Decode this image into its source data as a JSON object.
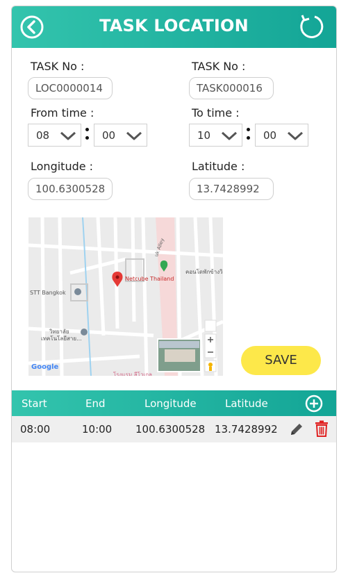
{
  "header": {
    "title": "TASK LOCATION"
  },
  "form": {
    "task_no_label_left": "TASK No :",
    "task_no_value_left": "LOC0000014",
    "task_no_label_right": "TASK No :",
    "task_no_value_right": "TASK000016",
    "from_time_label": "From time :",
    "from_hour": "08",
    "from_minute": "00",
    "to_time_label": "To time :",
    "to_hour": "10",
    "to_minute": "00",
    "longitude_label": "Longitude :",
    "longitude_value": "100.6300528",
    "latitude_label": "Latitude :",
    "latitude_value": "13.7428992"
  },
  "map": {
    "marker_label": "Netcube Thailand",
    "poi_stt": "STT Bangkok",
    "poi_vittaya": "วิทยาลัย",
    "poi_vittaya2": "เทคโนโลยีสาย...",
    "poi_condo": "คอนโดพักข้างวิ",
    "poi_bottom": "โรงแรม ลีโวเกล",
    "google_logo": "Google",
    "street_alley": "uk Alley"
  },
  "actions": {
    "save_label": "SAVE"
  },
  "table": {
    "headers": [
      "Start",
      "End",
      "Longitude",
      "Latitude"
    ],
    "rows": [
      {
        "start": "08:00",
        "end": "10:00",
        "longitude": "100.6300528",
        "latitude": "13.7428992"
      }
    ]
  },
  "colors": {
    "header_teal": "#1db3a0",
    "save_yellow": "#fde84a",
    "delete_red": "#e02020",
    "marker_red": "#e53935"
  }
}
